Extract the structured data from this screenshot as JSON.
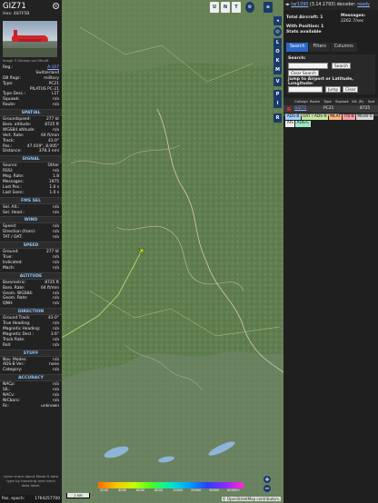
{
  "left_panel": {
    "callsign": "GIZ71",
    "hex": "Hex: 487F5B",
    "photo_credit": "Image © Nicolas von Muralt",
    "info": [
      {
        "k": "Reg.:",
        "v": "A-107",
        "link": true
      },
      {
        "k": "",
        "v": "Switzerland"
      },
      {
        "k": "DB flags:",
        "v": "military"
      },
      {
        "k": "Type:",
        "v": "PC21"
      },
      {
        "k": "",
        "v": "PILATUS PC-21"
      },
      {
        "k": "Type Desc.:",
        "v": "L1T"
      },
      {
        "k": "Squawk:",
        "v": "n/a"
      },
      {
        "k": "Route:",
        "v": "n/a"
      }
    ],
    "spatial_title": "SPATIAL",
    "spatial": [
      {
        "k": "Groundspeed:",
        "v": "277 kt"
      },
      {
        "k": "Baro. altitude:",
        "v": "8725 ft"
      },
      {
        "k": "WGS84 altitude:",
        "v": "n/a"
      },
      {
        "k": "Vert. Rate:",
        "v": "64 ft/min"
      },
      {
        "k": "Track:",
        "v": "43.0°"
      },
      {
        "k": "Pos.:",
        "v": "47.019°, 8.005°"
      },
      {
        "k": "Distance:",
        "v": "378.3 nmi"
      }
    ],
    "signal_title": "SIGNAL",
    "signal": [
      {
        "k": "Source:",
        "v": "Other"
      },
      {
        "k": "RSSI:",
        "v": "n/a"
      },
      {
        "k": "Msg. Rate:",
        "v": "1.8"
      },
      {
        "k": "Messages:",
        "v": "1975"
      },
      {
        "k": "Last Pos.:",
        "v": "1.0 s"
      },
      {
        "k": "Last Seen:",
        "v": "1.0 s"
      }
    ],
    "fms_title": "FMS SEL",
    "fms": [
      {
        "k": "Sel. Alt.:",
        "v": "n/a"
      },
      {
        "k": "Sel. Head.:",
        "v": "n/a"
      }
    ],
    "wind_title": "WIND",
    "wind": [
      {
        "k": "Speed:",
        "v": "n/a"
      },
      {
        "k": "Direction (from):",
        "v": "n/a"
      },
      {
        "k": "TAT / OAT:",
        "v": "n/a"
      }
    ],
    "speed_title": "SPEED",
    "speed": [
      {
        "k": "Ground:",
        "v": "277 kt"
      },
      {
        "k": "True:",
        "v": "n/a"
      },
      {
        "k": "Indicated:",
        "v": "n/a"
      },
      {
        "k": "Mach:",
        "v": "n/a"
      }
    ],
    "altitude_title": "ALTITUDE",
    "altitude": [
      {
        "k": "Barometric:",
        "v": "8725 ft"
      },
      {
        "k": "Baro. Rate:",
        "v": "64 ft/min"
      },
      {
        "k": "Geom. WGS84:",
        "v": "n/a"
      },
      {
        "k": "Geom. Rate:",
        "v": "n/a"
      },
      {
        "k": "QNH:",
        "v": "n/a"
      }
    ],
    "direction_title": "DIRECTION",
    "direction": [
      {
        "k": "Ground Track:",
        "v": "43.0°"
      },
      {
        "k": "True Heading:",
        "v": "n/a"
      },
      {
        "k": "Magnetic Heading:",
        "v": "n/a"
      },
      {
        "k": "Magnetic Decl.:",
        "v": "3.6°"
      },
      {
        "k": "Track Rate:",
        "v": "n/a"
      },
      {
        "k": "Roll:",
        "v": "n/a"
      }
    ],
    "stuff_title": "STUFF",
    "stuff": [
      {
        "k": "Nav. Modes:",
        "v": "n/a"
      },
      {
        "k": "ADS-B Ver.:",
        "v": "none"
      },
      {
        "k": "Category:",
        "v": "n/a"
      }
    ],
    "accuracy_title": "ACCURACY",
    "accuracy": [
      {
        "k": "NACp:",
        "v": "n/a"
      },
      {
        "k": "SIL:",
        "v": "n/a"
      },
      {
        "k": "NACv:",
        "v": "n/a"
      },
      {
        "k": "NICbaro:",
        "v": "n/a"
      },
      {
        "k": "Rc:",
        "v": "unknown"
      }
    ],
    "note": "Learn more about Mode S data type by hovering over each data label.",
    "epoch_label": "Pos. epoch:",
    "epoch_value": "1764257700"
  },
  "map": {
    "top_buttons": [
      "U",
      "N",
      "T"
    ],
    "side_buttons": [
      "L",
      "O",
      "K",
      "M",
      "V",
      "P",
      "I",
      "R"
    ],
    "zoom_in": "+",
    "zoom_out": "−",
    "scale_label": "2 NM",
    "altitude_labels": [
      "2000",
      "4000",
      "6000",
      "8000",
      "10000",
      "20000",
      "30000",
      "40000+"
    ],
    "attribution": "© OpenStreetMap contributors."
  },
  "right_panel": {
    "version": "tar1090",
    "version_detail": "(3.14.1793)",
    "decoder_label": "decoder:",
    "decoder_status": "ready",
    "total_aircraft_label": "Total Aircraft: 1",
    "with_position_label": "With Position: 1",
    "stats_label": "Stats available",
    "messages_label": "Messages:",
    "messages_value": "2262.7/sec",
    "tabs": [
      "Search",
      "Filters",
      "Columns"
    ],
    "search_label": "Search:",
    "search_button": "Search",
    "clear_search_button": "Clear Search",
    "jump_label": "Jump to Airport or Latitude, Longitude:",
    "jump_button": "Jump",
    "clear_button": "Clear",
    "columns": [
      "Callsign",
      "Route",
      "Type",
      "Squawk",
      "Alt. (ft)",
      "Spd"
    ],
    "rows": [
      {
        "callsign": "GIZ71",
        "route": "",
        "type": "PC21",
        "squawk": "",
        "alt": "8725",
        "spd": ""
      }
    ],
    "legend": [
      {
        "label": "ADS-B",
        "color": "#9ed1ff"
      },
      {
        "label": "UAT / ADS-R",
        "color": "#c6e79a"
      },
      {
        "label": "MLAT",
        "color": "#ffb27a"
      },
      {
        "label": "TIS-B",
        "color": "#ff9ea6"
      },
      {
        "label": "Mode-S",
        "color": "#d8d8d8"
      },
      {
        "label": "AIS",
        "color": "#eeeeee"
      },
      {
        "label": "ADS-C",
        "color": "#9be6c4"
      }
    ]
  }
}
